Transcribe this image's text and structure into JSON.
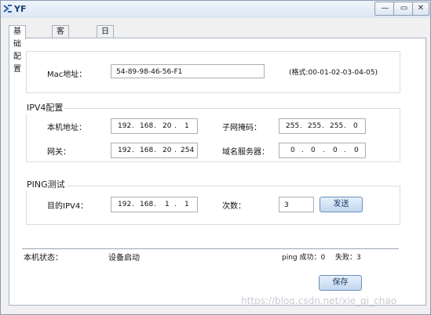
{
  "window": {
    "title": "YF",
    "minimize": "—",
    "maximize": "▭",
    "close": "✕"
  },
  "tabs": [
    {
      "label": "基础配置"
    },
    {
      "label": "客户端信息"
    },
    {
      "label": "日志信息"
    }
  ],
  "mac": {
    "label": "Mac地址：",
    "value": "54-89-98-46-56-F1",
    "hint": "(格式:00-01-02-03-04-05)"
  },
  "ipv4": {
    "title": "IPV4配置",
    "local_ip": {
      "label": "本机地址：",
      "octets": [
        "192",
        "168",
        "20",
        "1"
      ]
    },
    "subnet_mask": {
      "label": "子网掩码：",
      "octets": [
        "255",
        "255",
        "255",
        "0"
      ]
    },
    "gateway": {
      "label": "网关：",
      "octets": [
        "192",
        "168",
        "20",
        "254"
      ]
    },
    "dns": {
      "label": "域名服务器：",
      "octets": [
        "0",
        "0",
        "0",
        "0"
      ]
    }
  },
  "ping": {
    "title": "PING测试",
    "target": {
      "label": "目的IPV4：",
      "octets": [
        "192",
        "168",
        "1",
        "1"
      ]
    },
    "count": {
      "label": "次数：",
      "value": "3"
    },
    "send_button": "发送"
  },
  "status": {
    "label": "本机状态：",
    "value": "设备启动",
    "ping_success": "ping 成功：0",
    "fail": "失败：3"
  },
  "save_button": "保存",
  "watermark": "https://blog.csdn.net/xie_qi_chao"
}
